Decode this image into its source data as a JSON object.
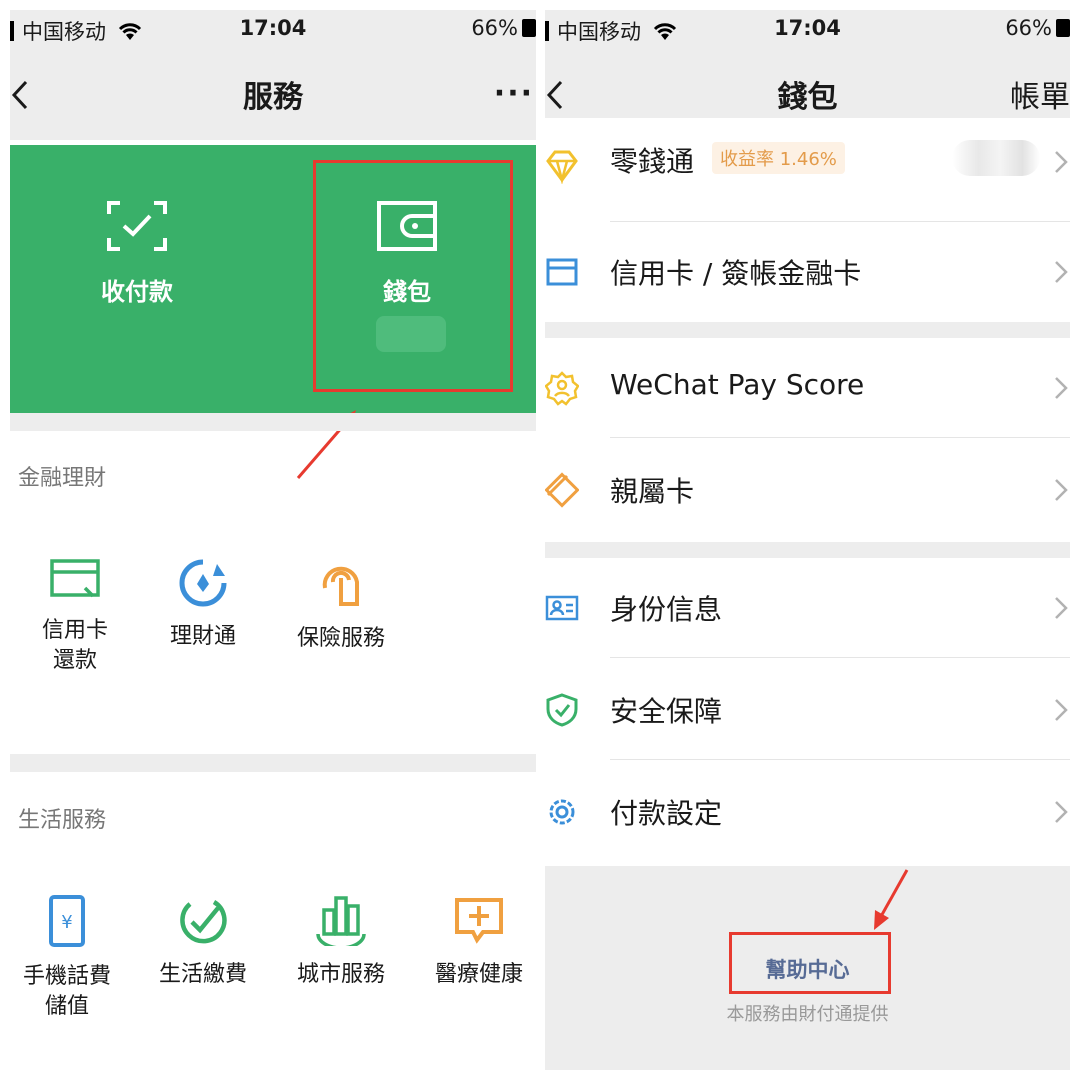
{
  "status": {
    "carrier": "中国移动",
    "time": "17:04",
    "battery": "66%"
  },
  "left": {
    "title": "服務",
    "more": "···",
    "banner": {
      "receive_label": "收付款",
      "wallet_label": "錢包"
    },
    "finance": {
      "title": "金融理財",
      "items": [
        {
          "label": "信用卡\n還款",
          "icon": "credit-card-icon"
        },
        {
          "label": "理財通",
          "icon": "wealth-icon"
        },
        {
          "label": "保險服務",
          "icon": "insurance-icon"
        }
      ]
    },
    "life": {
      "title": "生活服務",
      "items": [
        {
          "label": "手機話費\n儲值",
          "icon": "mobile-topup-icon"
        },
        {
          "label": "生活繳費",
          "icon": "utilities-icon"
        },
        {
          "label": "城市服務",
          "icon": "city-icon"
        },
        {
          "label": "醫療健康",
          "icon": "medical-icon"
        }
      ]
    }
  },
  "right": {
    "title": "錢包",
    "ledger": "帳單",
    "rows": [
      {
        "label": "零錢通",
        "badge": "收益率 1.46%",
        "icon": "diamond-icon",
        "color": "#f2c12e"
      },
      {
        "label": "信用卡 / 簽帳金融卡",
        "icon": "card-icon",
        "color": "#3b8fd9"
      },
      {
        "label": "WeChat Pay Score",
        "icon": "pay-score-icon",
        "color": "#f2c12e"
      },
      {
        "label": "親屬卡",
        "icon": "family-card-icon",
        "color": "#f0a040"
      },
      {
        "label": "身份信息",
        "icon": "id-card-icon",
        "color": "#3b8fd9"
      },
      {
        "label": "安全保障",
        "icon": "shield-icon",
        "color": "#39b069"
      },
      {
        "label": "付款設定",
        "icon": "gear-icon",
        "color": "#3b8fd9"
      }
    ],
    "help": "幫助中心",
    "provider": "本服務由財付通提供"
  },
  "colors": {
    "accent_green": "#39b069",
    "highlight_red": "#e73a2f",
    "link_blue": "#576b95"
  }
}
